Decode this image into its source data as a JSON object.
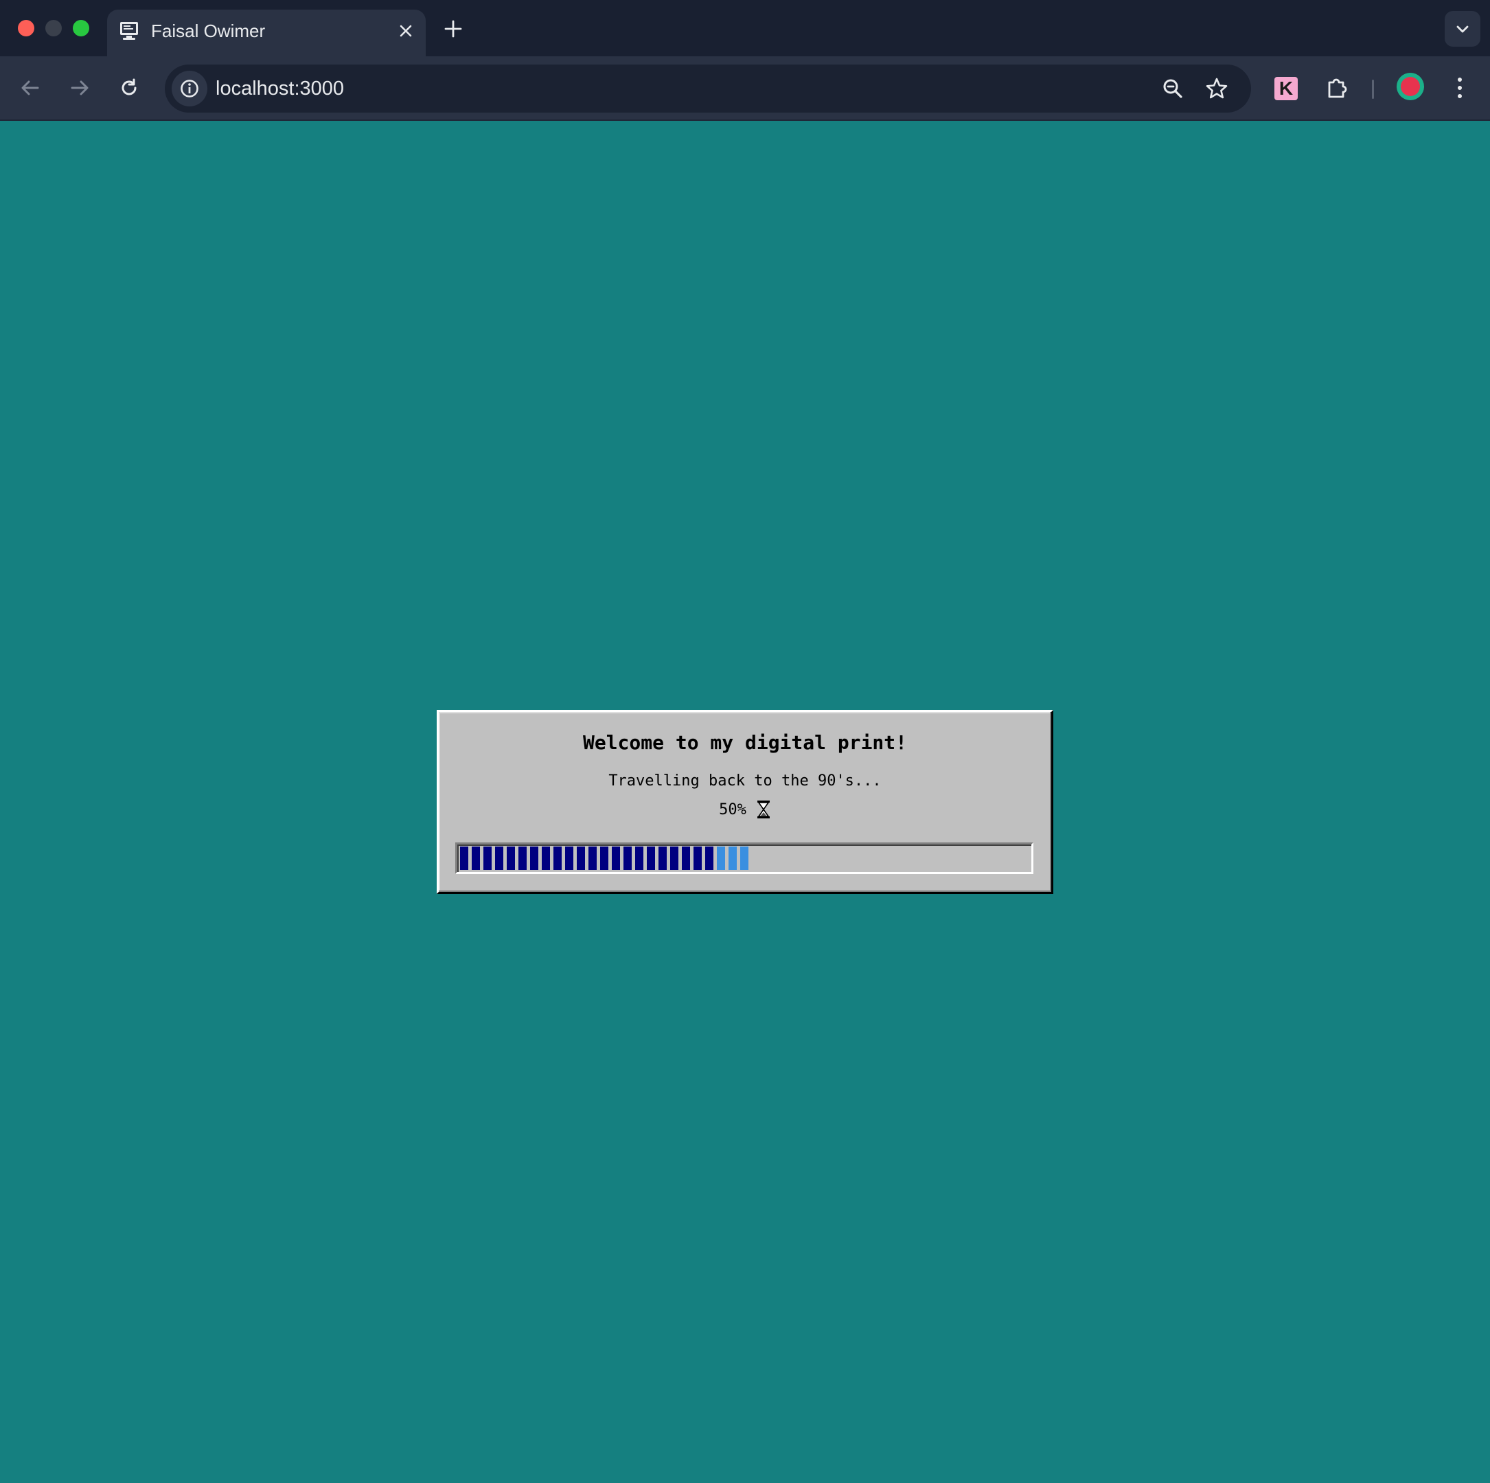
{
  "browser": {
    "tab": {
      "title": "Faisal Owimer"
    },
    "url": "localhost:3000",
    "extension_label": "K"
  },
  "dialog": {
    "title": "Welcome to my digital print!",
    "subtitle": "Travelling back to the 90's...",
    "percent_label": "50%",
    "progress": 0.5
  },
  "colors": {
    "page_background": "#158080",
    "dialog_background": "#c0c0c0",
    "progress_filled": "#000080",
    "progress_active": "#3a8fe0"
  }
}
